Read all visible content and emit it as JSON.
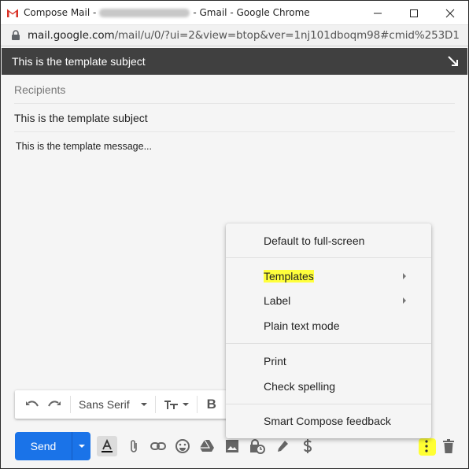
{
  "browser": {
    "tab_title_prefix": "Compose Mail - ",
    "tab_title_suffix": " - Gmail - Google Chrome",
    "url_host": "mail.google.com",
    "url_path": "/mail/u/0/?ui=2&view=btop&ver=1nj101dboqm98#cmid%253D1",
    "window_controls": {
      "minimize": "—",
      "maximize": "☐",
      "close": "✕"
    }
  },
  "compose": {
    "header_title": "This is the template subject",
    "recipients_placeholder": "Recipients",
    "subject_value": "This is the template subject",
    "body_text": "This is the template message..."
  },
  "format_toolbar": {
    "font_family": "Sans Serif",
    "bold_label": "B"
  },
  "actions": {
    "send_label": "Send"
  },
  "menu": {
    "items": [
      {
        "label": "Default to full-screen",
        "submenu": false,
        "highlighted": false
      },
      {
        "label": "Templates",
        "submenu": true,
        "highlighted": true
      },
      {
        "label": "Label",
        "submenu": true,
        "highlighted": false
      },
      {
        "label": "Plain text mode",
        "submenu": false,
        "highlighted": false
      },
      {
        "label": "Print",
        "submenu": false,
        "highlighted": false
      },
      {
        "label": "Check spelling",
        "submenu": false,
        "highlighted": false
      },
      {
        "label": "Smart Compose feedback",
        "submenu": false,
        "highlighted": false
      }
    ]
  },
  "colors": {
    "send_blue": "#1a73e8",
    "header_dark": "#404040",
    "highlight_yellow": "#ffff33"
  }
}
